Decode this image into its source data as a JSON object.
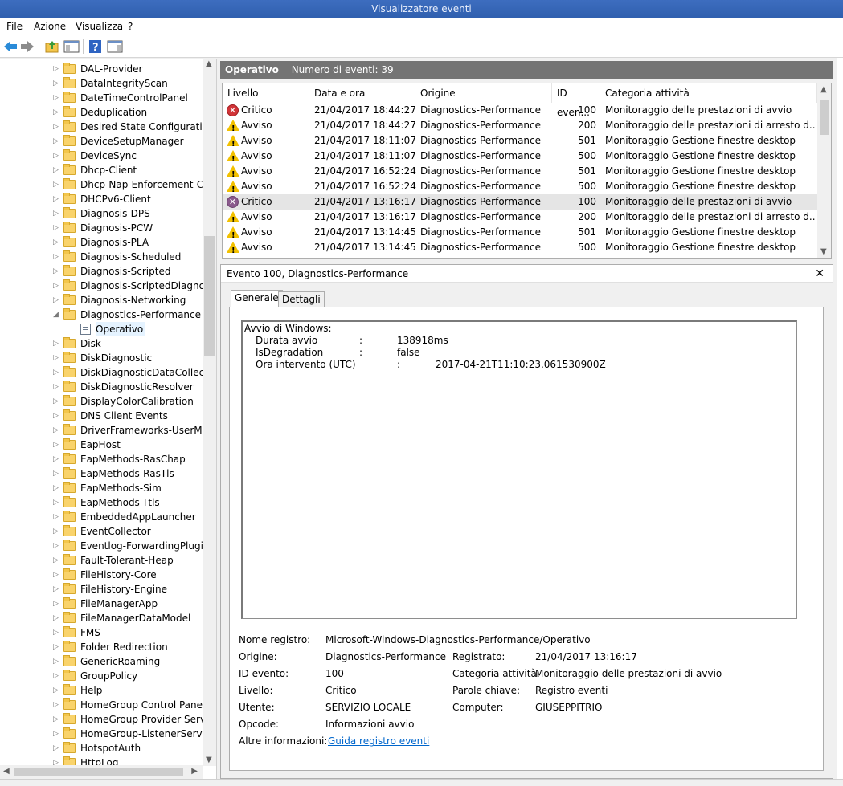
{
  "window": {
    "title": "Visualizzatore eventi"
  },
  "menu": [
    "File",
    "Azione",
    "Visualizza",
    "?"
  ],
  "tree": {
    "items": [
      "DAL-Provider",
      "DataIntegrityScan",
      "DateTimeControlPanel",
      "Deduplication",
      "Desired State Configuration",
      "DeviceSetupManager",
      "DeviceSync",
      "Dhcp-Client",
      "Dhcp-Nap-Enforcement-Clie",
      "DHCPv6-Client",
      "Diagnosis-DPS",
      "Diagnosis-PCW",
      "Diagnosis-PLA",
      "Diagnosis-Scheduled",
      "Diagnosis-Scripted",
      "Diagnosis-ScriptedDiagnosti",
      "Diagnosis-Networking",
      "Diagnostics-Performance",
      "Operativo",
      "Disk",
      "DiskDiagnostic",
      "DiskDiagnosticDataCollector",
      "DiskDiagnosticResolver",
      "DisplayColorCalibration",
      "DNS Client Events",
      "DriverFrameworks-UserMode",
      "EapHost",
      "EapMethods-RasChap",
      "EapMethods-RasTls",
      "EapMethods-Sim",
      "EapMethods-Ttls",
      "EmbeddedAppLauncher",
      "EventCollector",
      "Eventlog-ForwardingPlugin",
      "Fault-Tolerant-Heap",
      "FileHistory-Core",
      "FileHistory-Engine",
      "FileManagerApp",
      "FileManagerDataModel",
      "FMS",
      "Folder Redirection",
      "GenericRoaming",
      "GroupPolicy",
      "Help",
      "HomeGroup Control Panel",
      "HomeGroup Provider Service",
      "HomeGroup-ListenerService",
      "HotspotAuth",
      "HttpLog"
    ],
    "expanded_index": 17,
    "selected_index": 18
  },
  "list": {
    "name": "Operativo",
    "count_text": "Numero di eventi: 39",
    "columns": [
      "Livello",
      "Data e ora",
      "Origine",
      "ID even...",
      "Categoria attività"
    ],
    "rows": [
      {
        "level": "Critico",
        "type": "err",
        "date": "21/04/2017 18:44:27",
        "source": "Diagnostics-Performance",
        "id": "100",
        "category": "Monitoraggio delle prestazioni di avvio"
      },
      {
        "level": "Avviso",
        "type": "warn",
        "date": "21/04/2017 18:44:27",
        "source": "Diagnostics-Performance",
        "id": "200",
        "category": "Monitoraggio delle prestazioni di arresto d..."
      },
      {
        "level": "Avviso",
        "type": "warn",
        "date": "21/04/2017 18:11:07",
        "source": "Diagnostics-Performance",
        "id": "501",
        "category": "Monitoraggio Gestione finestre desktop"
      },
      {
        "level": "Avviso",
        "type": "warn",
        "date": "21/04/2017 18:11:07",
        "source": "Diagnostics-Performance",
        "id": "500",
        "category": "Monitoraggio Gestione finestre desktop"
      },
      {
        "level": "Avviso",
        "type": "warn",
        "date": "21/04/2017 16:52:24",
        "source": "Diagnostics-Performance",
        "id": "501",
        "category": "Monitoraggio Gestione finestre desktop"
      },
      {
        "level": "Avviso",
        "type": "warn",
        "date": "21/04/2017 16:52:24",
        "source": "Diagnostics-Performance",
        "id": "500",
        "category": "Monitoraggio Gestione finestre desktop"
      },
      {
        "level": "Critico",
        "type": "err2",
        "date": "21/04/2017 13:16:17",
        "source": "Diagnostics-Performance",
        "id": "100",
        "category": "Monitoraggio delle prestazioni di avvio"
      },
      {
        "level": "Avviso",
        "type": "warn",
        "date": "21/04/2017 13:16:17",
        "source": "Diagnostics-Performance",
        "id": "200",
        "category": "Monitoraggio delle prestazioni di arresto d..."
      },
      {
        "level": "Avviso",
        "type": "warn",
        "date": "21/04/2017 13:14:45",
        "source": "Diagnostics-Performance",
        "id": "501",
        "category": "Monitoraggio Gestione finestre desktop"
      },
      {
        "level": "Avviso",
        "type": "warn",
        "date": "21/04/2017 13:14:45",
        "source": "Diagnostics-Performance",
        "id": "500",
        "category": "Monitoraggio Gestione finestre desktop"
      }
    ],
    "selected_index": 6
  },
  "detail": {
    "title": "Evento 100, Diagnostics-Performance",
    "tabs": [
      "Generale",
      "Dettagli"
    ],
    "description": {
      "heading": "Avvio di Windows:",
      "lines": [
        {
          "key": "Durata avvio",
          "sep": ":",
          "value": "138918ms"
        },
        {
          "key": "IsDegradation",
          "sep": ":",
          "value": "false"
        },
        {
          "key": "Ora intervento (UTC)",
          "sep": ":",
          "value": "2017-04-21T11:10:23.061530900Z"
        }
      ]
    },
    "props": {
      "log_name_label": "Nome registro:",
      "log_name": "Microsoft-Windows-Diagnostics-Performance/Operativo",
      "source_label": "Origine:",
      "source": "Diagnostics-Performance",
      "logged_label": "Registrato:",
      "logged": "21/04/2017 13:16:17",
      "event_id_label": "ID evento:",
      "event_id": "100",
      "task_label": "Categoria attività:",
      "task": "Monitoraggio delle prestazioni di avvio",
      "level_label": "Livello:",
      "level": "Critico",
      "keywords_label": "Parole chiave:",
      "keywords": "Registro eventi",
      "user_label": "Utente:",
      "user": "SERVIZIO LOCALE",
      "computer_label": "Computer:",
      "computer": "GIUSEPPITRIO",
      "opcode_label": "Opcode:",
      "opcode": "Informazioni avvio",
      "more_label": "Altre informazioni:",
      "more_link": "Guida registro eventi"
    }
  },
  "colors": {
    "titlebar": "#2f5fae",
    "list_header": "#747474",
    "link": "#0066cc"
  }
}
